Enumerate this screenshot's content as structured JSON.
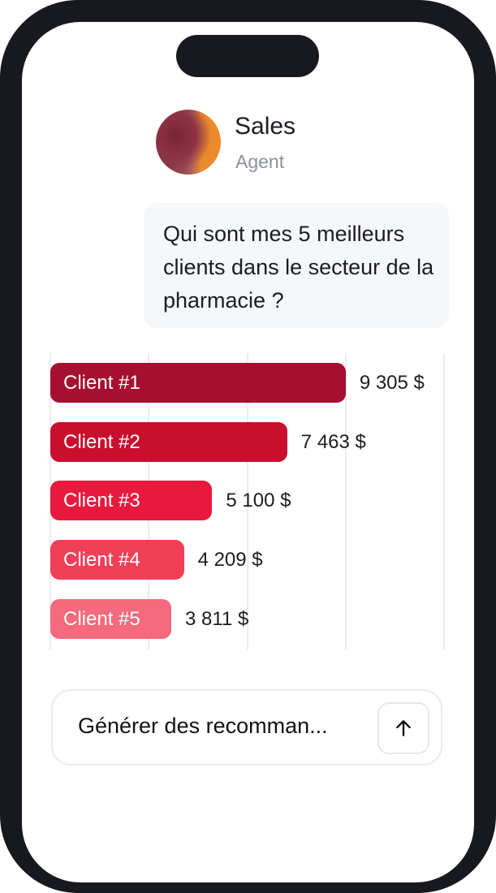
{
  "agent": {
    "name": "Sales",
    "role": "Agent"
  },
  "message": {
    "text": "Qui sont mes 5 meilleurs clients dans le secteur de la pharmacie ?"
  },
  "chart_data": {
    "type": "bar",
    "orientation": "horizontal",
    "categories": [
      "Client #1",
      "Client #2",
      "Client #3",
      "Client #4",
      "Client #5"
    ],
    "values": [
      9305,
      7463,
      5100,
      4209,
      3811
    ],
    "value_labels": [
      "9 305 $",
      "7 463 $",
      "5 100 $",
      "4 209 $",
      "3 811 $"
    ],
    "colors": [
      "#a60f30",
      "#c8102e",
      "#e8193d",
      "#f23f58",
      "#f56a7c"
    ],
    "grid": true
  },
  "input": {
    "value": "Générer des recomman..."
  },
  "icons": {
    "send": "arrow-up-icon"
  }
}
